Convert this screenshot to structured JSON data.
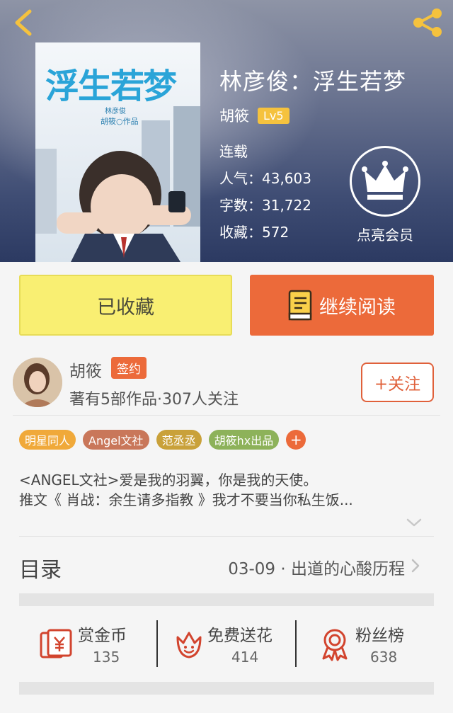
{
  "header": {
    "back_icon": "chevron-left-icon",
    "share_icon": "share-icon",
    "icon_color": "#f5c23e"
  },
  "book": {
    "title": "林彦俊：浮生若梦",
    "author": "胡筱",
    "level": "Lv5",
    "status": "连载",
    "popularity": "人气：43,603",
    "word_count": "字数：31,722",
    "favorites": "收藏：572"
  },
  "cover": {
    "title": "浮生若梦",
    "subtitle": "林彦俊",
    "credit": "胡筱○作品"
  },
  "vip": {
    "label": "点亮会员",
    "icon": "crown-icon"
  },
  "actions": {
    "collected_label": "已收藏",
    "read_label": "继续阅读",
    "read_icon": "book-icon"
  },
  "author_profile": {
    "name": "胡筱",
    "badge": "签约",
    "works": "著有5部作品·307人关注",
    "follow_label": "+关注"
  },
  "tags": [
    {
      "label": "明星同人",
      "color": "#f0a93a"
    },
    {
      "label": "Angel文社",
      "color": "#c9775a"
    },
    {
      "label": "范丞丞",
      "color": "#c9a13a"
    },
    {
      "label": "胡筱hx出品",
      "color": "#8db25a"
    }
  ],
  "tag_more": "+",
  "description": {
    "line1": "<ANGEL文社>爱是我的羽翼，你是我的天使。",
    "line2": "推文《 肖战：余生请多指教 》我才不要当你私生饭..."
  },
  "catalog": {
    "title": "目录",
    "latest": "03-09 · 出道的心酸历程"
  },
  "rewards": [
    {
      "label": "赏金币",
      "value": "135",
      "icon": "coin-envelope-icon"
    },
    {
      "label": "免费送花",
      "value": "414",
      "icon": "flower-icon"
    },
    {
      "label": "粉丝榜",
      "value": "638",
      "icon": "ribbon-badge-icon"
    }
  ],
  "colors": {
    "accent": "#ec6a3a",
    "collected_bg": "#f9ef72",
    "badge_yellow": "#f5c23e"
  }
}
